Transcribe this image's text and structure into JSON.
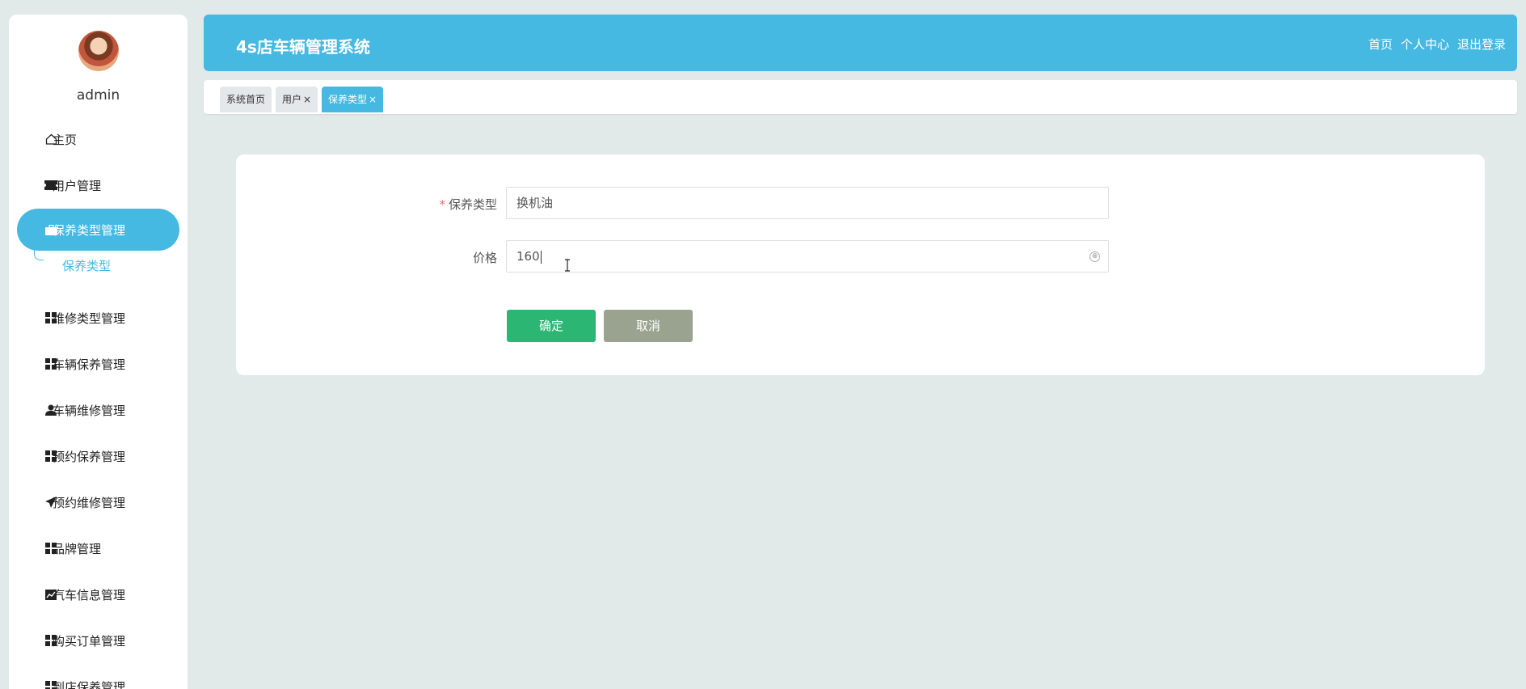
{
  "user": {
    "name": "admin"
  },
  "sidebar": {
    "items": [
      {
        "label": "主页",
        "icon": "home-icon"
      },
      {
        "label": "用户管理",
        "icon": "ticket-icon"
      },
      {
        "label": "保养类型管理",
        "icon": "briefcase-icon"
      },
      {
        "label": "维修类型管理",
        "icon": "grid-icon"
      },
      {
        "label": "车辆保养管理",
        "icon": "grid-icon"
      },
      {
        "label": "车辆维修管理",
        "icon": "user-icon"
      },
      {
        "label": "预约保养管理",
        "icon": "grid-icon"
      },
      {
        "label": "预约维修管理",
        "icon": "send-icon"
      },
      {
        "label": "品牌管理",
        "icon": "grid-icon"
      },
      {
        "label": "汽车信息管理",
        "icon": "chart-icon"
      },
      {
        "label": "购买订单管理",
        "icon": "grid-icon"
      },
      {
        "label": "到店保养管理",
        "icon": "grid-icon"
      }
    ],
    "submenu": {
      "label": "保养类型"
    }
  },
  "header": {
    "title": "4s店车辆管理系统",
    "links": [
      "首页",
      "个人中心",
      "退出登录"
    ]
  },
  "tabs": [
    {
      "label": "系统首页",
      "closable": false
    },
    {
      "label": "用户",
      "closable": true
    },
    {
      "label": "保养类型",
      "closable": true
    }
  ],
  "tab_close": "×",
  "form": {
    "type_label": "保养类型",
    "type_value": "换机油",
    "price_label": "价格",
    "price_value": "160",
    "required_mark": "*",
    "clear_icon": "⊗",
    "ok_label": "确定",
    "cancel_label": "取消"
  },
  "colors": {
    "primary": "#45b9e2",
    "success": "#2bb673",
    "cancel": "#9aa38f",
    "background": "#e2e9e9"
  }
}
